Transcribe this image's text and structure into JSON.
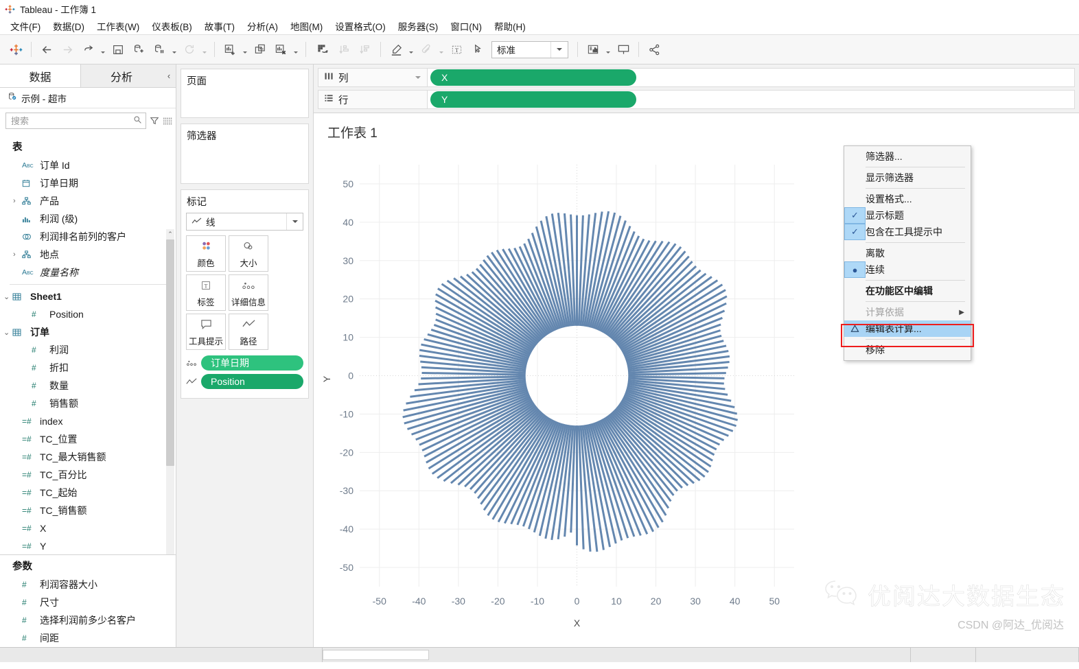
{
  "window": {
    "title": "Tableau - 工作簿 1",
    "logo_icon": "tableau-logo"
  },
  "menubar": {
    "items": [
      {
        "label": "文件(F)"
      },
      {
        "label": "数据(D)"
      },
      {
        "label": "工作表(W)"
      },
      {
        "label": "仪表板(B)"
      },
      {
        "label": "故事(T)"
      },
      {
        "label": "分析(A)"
      },
      {
        "label": "地图(M)"
      },
      {
        "label": "设置格式(O)"
      },
      {
        "label": "服务器(S)"
      },
      {
        "label": "窗口(N)"
      },
      {
        "label": "帮助(H)"
      }
    ]
  },
  "toolbar": {
    "fit_value": "标准",
    "icons": [
      "tableau-home-icon",
      "back-icon",
      "forward-icon",
      "undo-redo-icon",
      "save-icon",
      "new-data-source-icon",
      "pause-data-source-icon",
      "refresh-icon",
      "new-worksheet-icon",
      "duplicate-sheet-icon",
      "clear-sheet-icon",
      "swap-rows-columns-icon",
      "sort-ascending-icon",
      "sort-descending-icon",
      "highlight-icon",
      "attachment-icon",
      "text-box-icon",
      "fix-axis-icon",
      "show-me-icon",
      "presentation-mode-icon",
      "share-icon"
    ]
  },
  "left_pane": {
    "tabs": [
      {
        "label": "数据",
        "active": true
      },
      {
        "label": "分析",
        "active": false
      }
    ],
    "collapse_icon": "chevron-left-icon",
    "datasource": {
      "label": "示例 - 超市",
      "icon": "database-icon"
    },
    "search": {
      "placeholder": "搜索",
      "value": ""
    },
    "search_icons": [
      "search-icon",
      "filter-icon",
      "list-view-icon",
      "chevron-down-icon"
    ],
    "groups": [
      {
        "title": "表",
        "fields": [
          {
            "label": "订单 Id",
            "icon": "abc-icon",
            "indent": 1
          },
          {
            "label": "订单日期",
            "icon": "calendar-icon",
            "indent": 1
          },
          {
            "label": "产品",
            "icon": "hierarchy-icon",
            "indent": 0,
            "expander": "›"
          },
          {
            "label": "利润 (级)",
            "icon": "bin-icon",
            "indent": 1
          },
          {
            "label": "利润排名前列的客户",
            "icon": "set-icon",
            "indent": 1
          },
          {
            "label": "地点",
            "icon": "hierarchy-icon",
            "indent": 0,
            "expander": "›"
          },
          {
            "label": "度量名称",
            "icon": "abc-icon",
            "indent": 1,
            "italic": true
          }
        ]
      },
      {
        "title": "",
        "fields": [
          {
            "label": "Sheet1",
            "icon": "table-icon",
            "indent": 0,
            "expander": "⌄",
            "bold": true
          },
          {
            "label": "Position",
            "icon": "num-icon",
            "indent": 2
          },
          {
            "label": "订单",
            "icon": "table-icon",
            "indent": 0,
            "expander": "⌄",
            "bold": true
          },
          {
            "label": "利润",
            "icon": "num-icon",
            "indent": 2
          },
          {
            "label": "折扣",
            "icon": "num-icon",
            "indent": 2
          },
          {
            "label": "数量",
            "icon": "num-icon",
            "indent": 2
          },
          {
            "label": "销售额",
            "icon": "num-icon",
            "indent": 2
          },
          {
            "label": "index",
            "icon": "calc-num-icon",
            "indent": 1
          },
          {
            "label": "TC_位置",
            "icon": "calc-num-icon",
            "indent": 1
          },
          {
            "label": "TC_最大销售额",
            "icon": "calc-num-icon",
            "indent": 1
          },
          {
            "label": "TC_百分比",
            "icon": "calc-num-icon",
            "indent": 1
          },
          {
            "label": "TC_起始",
            "icon": "calc-num-icon",
            "indent": 1
          },
          {
            "label": "TC_销售额",
            "icon": "calc-num-icon",
            "indent": 1
          },
          {
            "label": "X",
            "icon": "calc-num-icon",
            "indent": 1
          },
          {
            "label": "Y",
            "icon": "calc-num-icon",
            "indent": 1
          }
        ]
      }
    ],
    "parameters": {
      "title": "参数",
      "fields": [
        {
          "label": "利润容器大小",
          "icon": "num-icon"
        },
        {
          "label": "尺寸",
          "icon": "num-icon"
        },
        {
          "label": "选择利润前多少名客户",
          "icon": "num-icon"
        },
        {
          "label": "间距",
          "icon": "num-icon"
        }
      ]
    }
  },
  "cards": {
    "pages": {
      "title": "页面"
    },
    "filters": {
      "title": "筛选器"
    },
    "marks": {
      "title": "标记",
      "mark_type": "线",
      "mark_type_icon": "line-mark-icon",
      "buttons": [
        {
          "label": "颜色",
          "icon": "color-icon"
        },
        {
          "label": "大小",
          "icon": "size-icon"
        },
        {
          "label": "标签",
          "icon": "label-icon"
        },
        {
          "label": "详细信息",
          "icon": "detail-icon"
        },
        {
          "label": "工具提示",
          "icon": "tooltip-icon"
        },
        {
          "label": "路径",
          "icon": "path-icon"
        }
      ],
      "pills": [
        {
          "label": "订单日期",
          "icon": "detail-icon",
          "shade": "light"
        },
        {
          "label": "Position",
          "icon": "path-icon",
          "shade": "dark"
        }
      ]
    }
  },
  "shelves": {
    "columns": {
      "label": "列",
      "icon": "columns-icon",
      "pill": "X"
    },
    "rows": {
      "label": "行",
      "icon": "rows-icon",
      "pill": "Y"
    }
  },
  "worksheet": {
    "title": "工作表 1"
  },
  "context_menu": {
    "items": [
      {
        "label": "筛选器...",
        "type": "item"
      },
      {
        "type": "separator"
      },
      {
        "label": "显示筛选器",
        "type": "item"
      },
      {
        "type": "separator"
      },
      {
        "label": "设置格式...",
        "type": "item"
      },
      {
        "label": "显示标题",
        "type": "item",
        "mark": "✓"
      },
      {
        "label": "包含在工具提示中",
        "type": "item",
        "mark": "✓"
      },
      {
        "type": "separator"
      },
      {
        "label": "离散",
        "type": "item"
      },
      {
        "label": "连续",
        "type": "item",
        "mark": "●"
      },
      {
        "type": "separator"
      },
      {
        "label": "在功能区中编辑",
        "type": "item",
        "bold": true
      },
      {
        "type": "separator"
      },
      {
        "label": "计算依据",
        "type": "item",
        "disabled": true,
        "submenu": "▶"
      },
      {
        "label": "编辑表计算...",
        "type": "item",
        "selected": true,
        "icon": "delta-icon"
      },
      {
        "type": "separator"
      },
      {
        "label": "移除",
        "type": "item"
      }
    ],
    "highlight_color": "#ee1c1c"
  },
  "watermark": {
    "brand": "优阅达大数据生态",
    "credit": "CSDN @阿达_优阅达",
    "icon": "wechat-icon"
  },
  "chart_data": {
    "type": "scatter",
    "title": "工作表 1",
    "xlabel": "X",
    "ylabel": "Y",
    "xlim": [
      -55,
      55
    ],
    "ylim": [
      -55,
      55
    ],
    "xticks": [
      -50,
      -40,
      -30,
      -20,
      -10,
      0,
      10,
      20,
      30,
      40,
      50
    ],
    "yticks": [
      50,
      40,
      30,
      20,
      10,
      0,
      -10,
      -20,
      -30,
      -40,
      -50
    ],
    "grid": true,
    "legend": "none",
    "mark_color": "#5c81ab",
    "description": "Radial spoke (sunburst) chart: ~170 line marks radiating from an inner radius to varying outer radii forming a rough circle.",
    "inner_radius": 13,
    "outer_radius_min": 34,
    "outer_radius_max": 47,
    "spoke_count": 170,
    "line_width": 3
  }
}
